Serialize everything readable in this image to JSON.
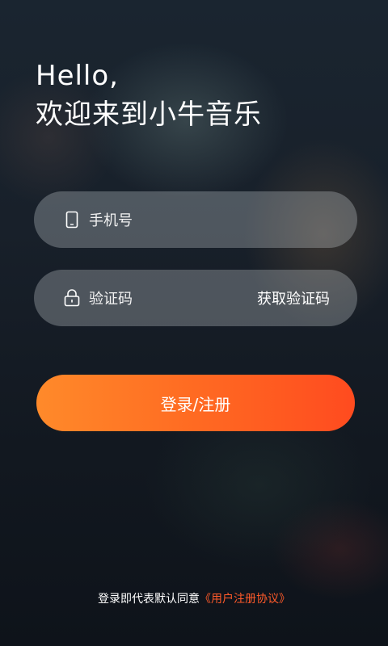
{
  "greeting": {
    "line1": "Hello,",
    "line2": "欢迎来到小牛音乐"
  },
  "phone_field": {
    "icon": "phone-icon",
    "placeholder": "手机号"
  },
  "code_field": {
    "icon": "lock-icon",
    "placeholder": "验证码",
    "get_code_label": "获取验证码"
  },
  "login_button": {
    "label": "登录/注册"
  },
  "agreement": {
    "prefix": "登录即代表默认同意",
    "link_label": "《用户注册协议》"
  },
  "colors": {
    "accent_start": "#ff8a2a",
    "accent_end": "#ff4b1f",
    "link": "#ff5a2a"
  }
}
